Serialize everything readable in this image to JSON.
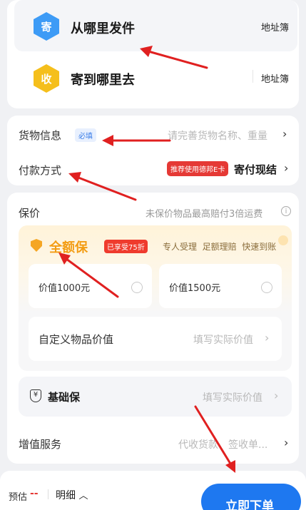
{
  "sender": {
    "icon_char": "寄",
    "title": "从哪里发件",
    "address_book": "地址簿"
  },
  "receiver": {
    "icon_char": "收",
    "title": "寄到哪里去",
    "address_book": "地址簿"
  },
  "goods": {
    "label": "货物信息",
    "tag": "必填",
    "placeholder": "请完善货物名称、重量"
  },
  "payment": {
    "label": "付款方式",
    "promo": "推荐使用德邦E卡",
    "value": "寄付现结"
  },
  "insurance": {
    "label": "保价",
    "note": "未保价物品最高赔付3倍运费",
    "full": {
      "title": "全额保",
      "badge": "已享受75折",
      "slogan": "专人受理  足额理赔  快速到账"
    },
    "options": [
      {
        "label": "价值1000元"
      },
      {
        "label": "价值1500元"
      }
    ],
    "custom": {
      "label": "自定义物品价值",
      "placeholder": "填写实际价值"
    },
    "basic": {
      "title": "基础保",
      "placeholder": "填写实际价值"
    }
  },
  "value_added": {
    "label": "增值服务",
    "hint": "代收货款、签收单..."
  },
  "footer": {
    "estimate_label": "预估",
    "estimate_value": "--",
    "detail": "明细",
    "submit": "立即下单"
  },
  "colors": {
    "accent": "#1e78f0",
    "orange": "#f39c12",
    "red": "#e53935",
    "annotation_arrow": "#e02020"
  }
}
